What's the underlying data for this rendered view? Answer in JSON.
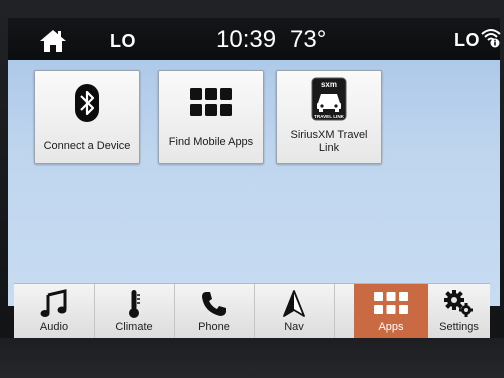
{
  "status_bar": {
    "fan_left": "LO",
    "time": "10:39",
    "temperature": "73°",
    "fan_right": "LO"
  },
  "apps": [
    {
      "label": "Connect a Device",
      "icon": "bluetooth-icon"
    },
    {
      "label": "Find Mobile Apps",
      "icon": "grid-icon"
    },
    {
      "label": "SiriusXM Travel Link",
      "icon": "siriusxm-travel-link-icon"
    }
  ],
  "nav": {
    "audio": "Audio",
    "climate": "Climate",
    "phone": "Phone",
    "nav": "Nav",
    "apps": "Apps",
    "settings": "Settings"
  },
  "active_nav": "apps",
  "colors": {
    "screen_background": "#bdd4ee",
    "active_tab": "#c96a43",
    "status_bar": "#0f1012"
  },
  "logo_text": {
    "sxm_badge_top": "sxm",
    "sxm_badge_bottom": "TRAVEL LINK"
  }
}
